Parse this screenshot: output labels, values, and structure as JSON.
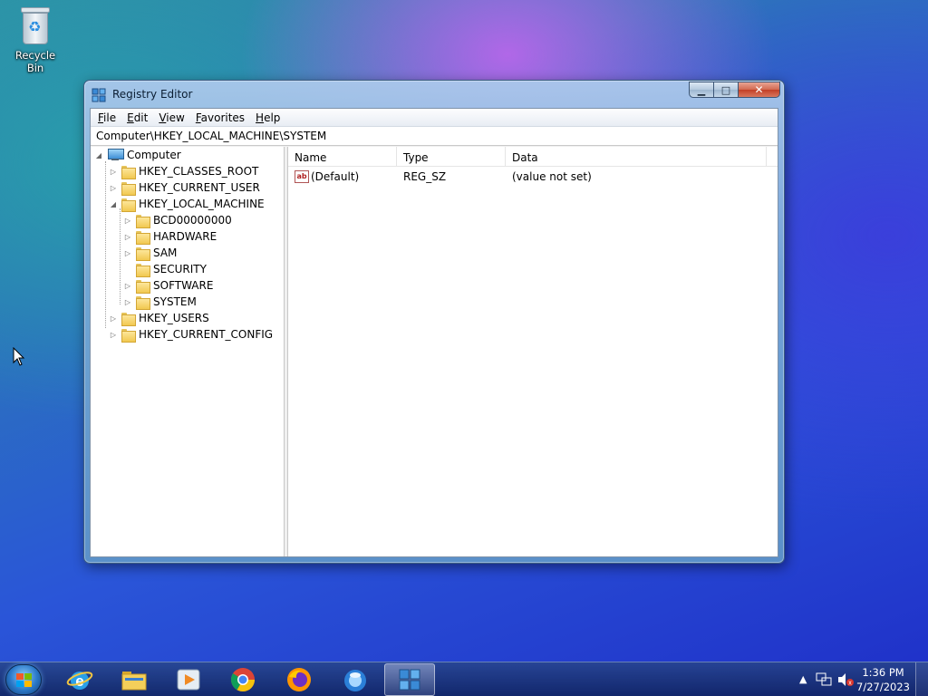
{
  "desktop": {
    "icons": [
      {
        "label": "Recycle Bin",
        "icon": "recycle-bin-icon"
      }
    ]
  },
  "window": {
    "title": "Registry Editor",
    "icon": "registry-editor-icon",
    "controls": {
      "minimize": "minimize-icon",
      "maximize": "maximize-icon",
      "close": "close-icon"
    },
    "menu": [
      {
        "label": "File",
        "accel": "F",
        "rest": "ile"
      },
      {
        "label": "Edit",
        "accel": "E",
        "rest": "dit"
      },
      {
        "label": "View",
        "accel": "V",
        "rest": "iew"
      },
      {
        "label": "Favorites",
        "accel": "F",
        "rest": "avorites",
        "prefix": ""
      },
      {
        "label": "Help",
        "accel": "H",
        "rest": "elp"
      }
    ],
    "address": "Computer\\HKEY_LOCAL_MACHINE\\SYSTEM",
    "tree": {
      "root": "Computer",
      "nodes": [
        {
          "label": "HKEY_CLASSES_ROOT",
          "expander": "▷"
        },
        {
          "label": "HKEY_CURRENT_USER",
          "expander": "▷"
        },
        {
          "label": "HKEY_LOCAL_MACHINE",
          "expander": "◢"
        },
        {
          "label": "BCD00000000",
          "expander": "▷"
        },
        {
          "label": "HARDWARE",
          "expander": "▷"
        },
        {
          "label": "SAM",
          "expander": "▷"
        },
        {
          "label": "SECURITY",
          "expander": ""
        },
        {
          "label": "SOFTWARE",
          "expander": "▷"
        },
        {
          "label": "SYSTEM",
          "expander": "▷"
        },
        {
          "label": "HKEY_USERS",
          "expander": "▷"
        },
        {
          "label": "HKEY_CURRENT_CONFIG",
          "expander": "▷"
        }
      ]
    },
    "list": {
      "columns": [
        "Name",
        "Type",
        "Data"
      ],
      "rows": [
        {
          "name": "(Default)",
          "type": "REG_SZ",
          "data": "(value not set)",
          "icon": "string-value-icon"
        }
      ]
    }
  },
  "taskbar": {
    "start": "start-orb-icon",
    "pinned": [
      {
        "name": "internet-explorer-icon",
        "active": false
      },
      {
        "name": "file-explorer-icon",
        "active": false
      },
      {
        "name": "media-player-icon",
        "active": false
      },
      {
        "name": "chrome-icon",
        "active": false
      },
      {
        "name": "firefox-icon",
        "active": false
      },
      {
        "name": "app-globe-icon",
        "active": false
      },
      {
        "name": "registry-editor-icon",
        "active": true
      }
    ],
    "tray": {
      "icons": [
        "show-hidden-icons-icon",
        "network-icon",
        "volume-muted-icon"
      ],
      "time": "1:36 PM",
      "date": "7/27/2023"
    }
  }
}
